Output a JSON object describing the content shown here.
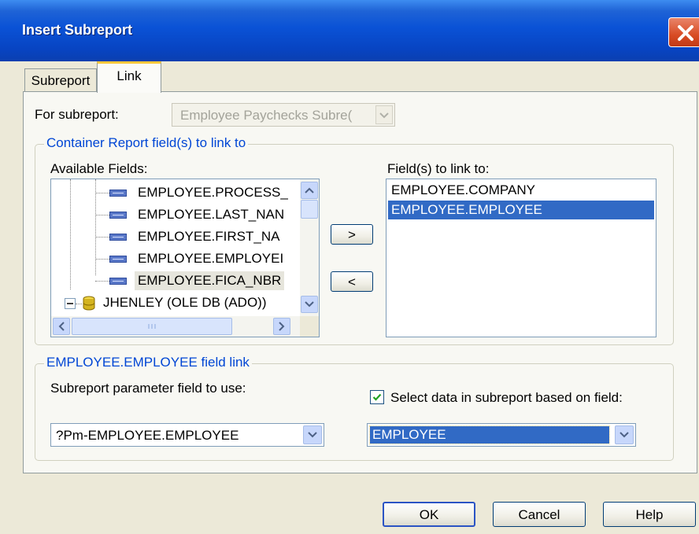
{
  "window": {
    "title": "Insert Subreport"
  },
  "tabs": [
    {
      "label": "Subreport"
    },
    {
      "label": "Link"
    }
  ],
  "for_subreport": {
    "label": "For subreport:",
    "value": "Employee Paychecks Subre("
  },
  "container_group": {
    "title": "Container Report field(s) to link to",
    "available_label": "Available Fields:",
    "link_label": "Field(s) to link to:",
    "available_fields": [
      "EMPLOYEE.PROCESS_",
      "EMPLOYEE.LAST_NAN",
      "EMPLOYEE.FIRST_NA",
      "EMPLOYEE.EMPLOYEI",
      "EMPLOYEE.FICA_NBR"
    ],
    "datasource": "JHENLEY (OLE DB (ADO))",
    "linked_fields": [
      "EMPLOYEE.COMPANY",
      "EMPLOYEE.EMPLOYEE"
    ],
    "add_button": ">",
    "remove_button": "<"
  },
  "field_link_group": {
    "title": "EMPLOYEE.EMPLOYEE field link",
    "param_label": "Subreport parameter field to use:",
    "param_value": "?Pm-EMPLOYEE.EMPLOYEE",
    "select_checkbox_label": "Select data in subreport based on field:",
    "select_checked": true,
    "select_value": "EMPLOYEE"
  },
  "buttons": {
    "ok": "OK",
    "cancel": "Cancel",
    "help": "Help"
  },
  "colors": {
    "titlebar": "#0a52d6",
    "selection": "#316ac5",
    "group_title": "#0046d5",
    "dialog_bg": "#ece9d8"
  }
}
